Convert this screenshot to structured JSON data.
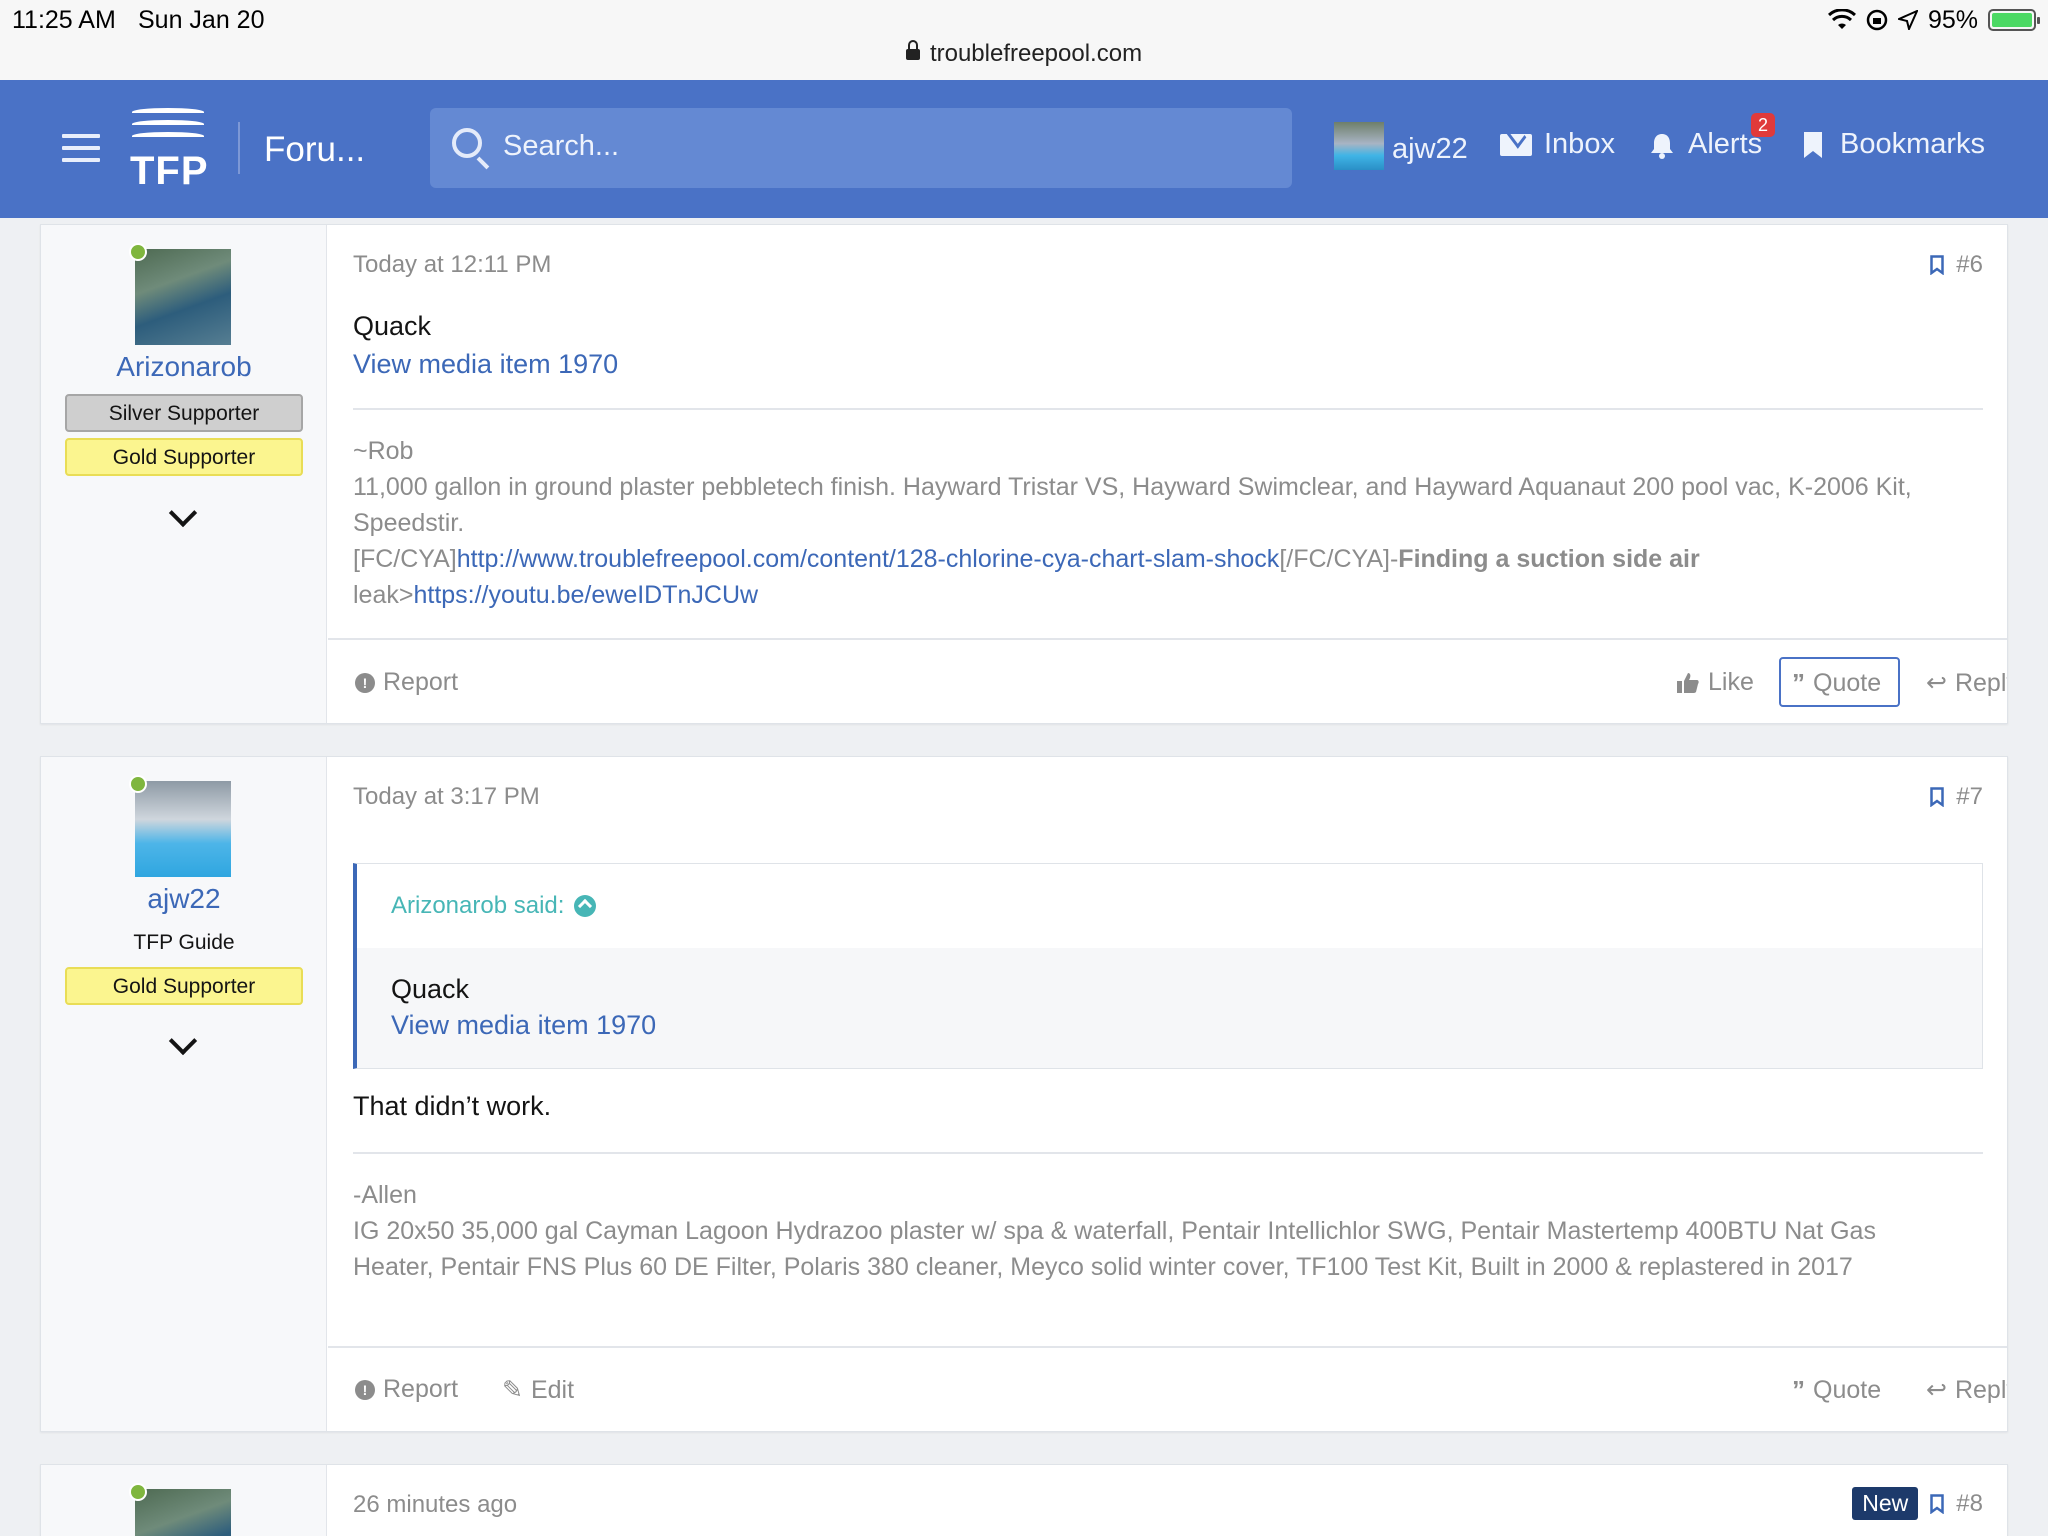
{
  "status_bar": {
    "time": "11:25 AM",
    "date": "Sun Jan 20",
    "url": "troublefreepool.com",
    "battery": "95%"
  },
  "header": {
    "logo_text": "TFP",
    "title": "Foru...",
    "search_placeholder": "Search...",
    "username": "ajw22",
    "inbox": "Inbox",
    "alerts": "Alerts",
    "alerts_count": "2",
    "bookmarks": "Bookmarks"
  },
  "posts": [
    {
      "author": "Arizonarob",
      "banners": [
        "Silver Supporter",
        "Gold Supporter"
      ],
      "date": "Today at 12:11 PM",
      "number": "#6",
      "body_text": "Quack",
      "body_link": "View media item 1970",
      "sig_name": "~Rob",
      "sig_line1": "11,000 gallon in ground plaster pebbletech finish. Hayward Tristar VS, Hayward Swimclear, and Hayward Aquanaut 200 pool vac, K-2006 Kit, Speedstir.",
      "sig_fc_open": "[FC/CYA]",
      "sig_link1": "http://www.troublefreepool.com/content/128-chlorine-cya-chart-slam-shock",
      "sig_fc_close": "[/FC/CYA]-",
      "sig_bold": "Finding a suction side air",
      "sig_leak": "leak>",
      "sig_link2": "https://youtu.be/eweIDTnJCUw",
      "actions": {
        "report": "Report",
        "like": "Like",
        "quote": "Quote",
        "reply": "Reply"
      }
    },
    {
      "author": "ajw22",
      "user_title": "TFP Guide",
      "banners": [
        "Gold Supporter"
      ],
      "date": "Today at 3:17 PM",
      "number": "#7",
      "quote_author": "Arizonarob said:",
      "quote_text": "Quack",
      "quote_link": "View media item 1970",
      "body_text": "That didn’t work.",
      "sig_name": "-Allen",
      "sig_text": "IG 20x50 35,000 gal Cayman Lagoon Hydrazoo plaster w/ spa & waterfall, Pentair Intellichlor SWG, Pentair Mastertemp 400BTU Nat Gas Heater, Pentair FNS Plus 60 DE Filter, Polaris 380 cleaner, Meyco solid winter cover, TF100 Test Kit, Built in 2000 & replastered in 2017",
      "actions": {
        "report": "Report",
        "edit": "Edit",
        "quote": "Quote",
        "reply": "Reply"
      }
    },
    {
      "date": "26 minutes ago",
      "badge": "New",
      "number": "#8"
    }
  ]
}
